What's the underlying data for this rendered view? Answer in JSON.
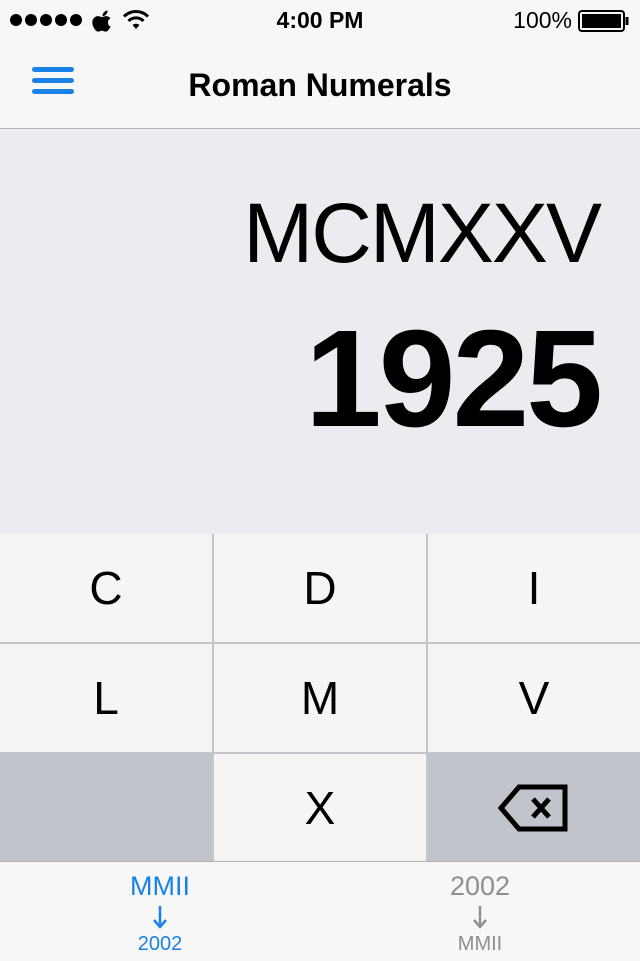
{
  "status_bar": {
    "time": "4:00 PM",
    "battery": "100%",
    "signal_icon": "signal-dots-icon",
    "apple_icon": "apple-icon",
    "wifi_icon": "wifi-icon",
    "battery_icon": "battery-full-icon"
  },
  "nav": {
    "title": "Roman Numerals",
    "menu_icon": "hamburger-menu-icon",
    "accent_color": "#1a82e6"
  },
  "display": {
    "roman": "MCMXXV",
    "arabic": "1925"
  },
  "keypad": {
    "keys": [
      "C",
      "D",
      "I",
      "L",
      "M",
      "V",
      "",
      "X",
      "backspace"
    ],
    "backspace_icon": "backspace-icon"
  },
  "tabs": [
    {
      "top": "MMII",
      "bottom": "2002",
      "selected": true
    },
    {
      "top": "2002",
      "bottom": "MMII",
      "selected": false
    }
  ],
  "colors": {
    "accent": "#1a82e6",
    "inactive": "#8e8e93",
    "display_bg": "#ebebf0",
    "key_bg": "#f5f5f5",
    "key_dark_bg": "#c2c4cc"
  }
}
